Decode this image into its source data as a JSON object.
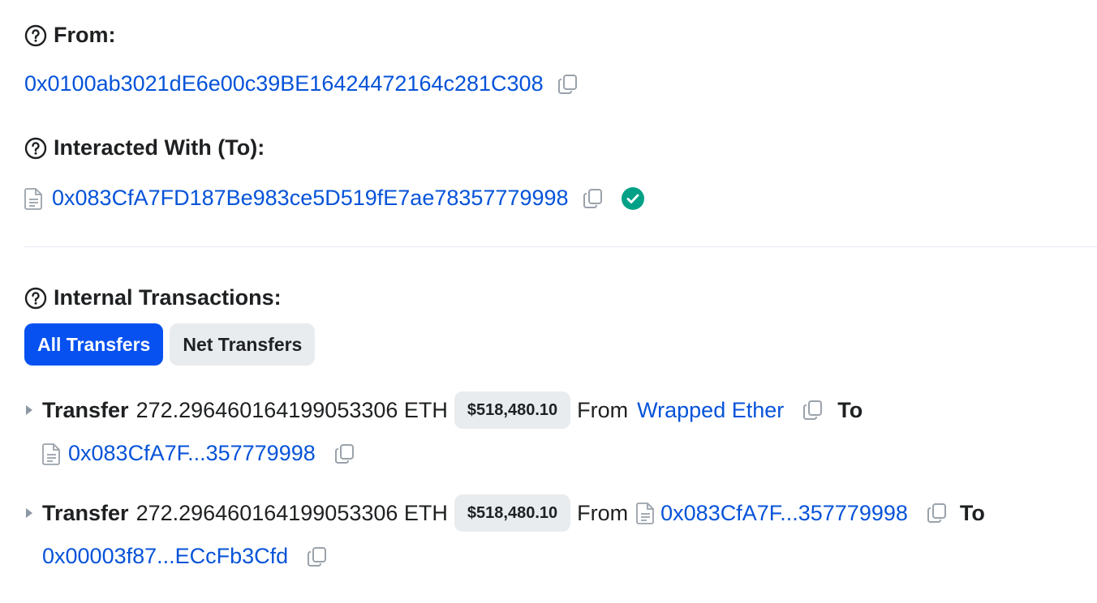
{
  "from": {
    "label": "From:",
    "address": "0x0100ab3021dE6e00c39BE16424472164c281C308"
  },
  "interacted": {
    "label": "Interacted With (To):",
    "address": "0x083CfA7FD187Be983ce5D519fE7ae78357779998"
  },
  "internal": {
    "label": "Internal Transactions:",
    "tabs": [
      {
        "label": "All Transfers",
        "active": true
      },
      {
        "label": "Net Transfers",
        "active": false
      }
    ],
    "transfers": [
      {
        "type": "Transfer",
        "amount": "272.296460164199053306 ETH",
        "usd": "$518,480.10",
        "from_word": "From",
        "from": "Wrapped Ether",
        "to_word": "To",
        "to": "0x083CfA7F...357779998"
      },
      {
        "type": "Transfer",
        "amount": "272.296460164199053306 ETH",
        "usd": "$518,480.10",
        "from_word": "From",
        "from": "0x083CfA7F...357779998",
        "to_word": "To",
        "to": "0x00003f87...ECcFb3Cfd"
      }
    ]
  },
  "colors": {
    "link": "#0653d9",
    "accent": "#0651f0",
    "verified": "#00a186"
  },
  "icons": [
    "help-icon",
    "copy-icon",
    "contract-document-icon",
    "verified-check-icon",
    "expand-caret-icon"
  ]
}
